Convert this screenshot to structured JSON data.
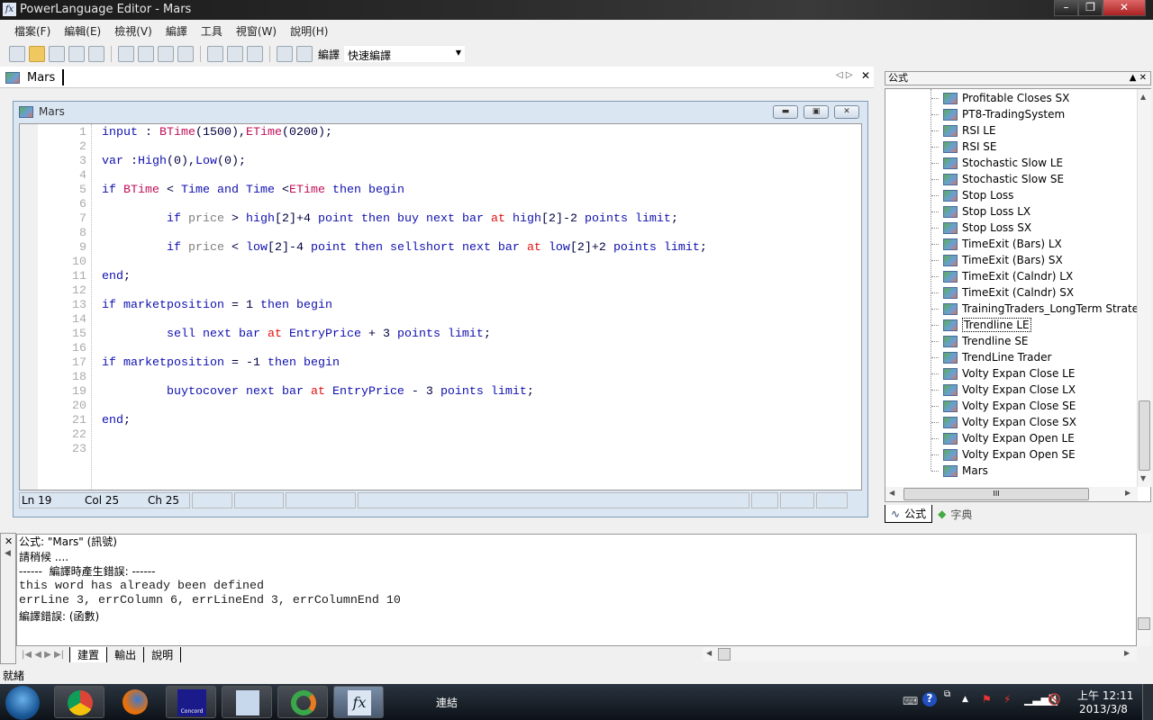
{
  "window": {
    "title": "PowerLanguage Editor - Mars"
  },
  "menu": [
    "檔案(F)",
    "編輯(E)",
    "檢視(V)",
    "編譯",
    "工具",
    "視窗(W)",
    "說明(H)"
  ],
  "toolbar": {
    "compile_label": "編譯",
    "mode_value": "快速編譯"
  },
  "doc_tab": {
    "label": "Mars"
  },
  "editor": {
    "title": "Mars",
    "lines": [
      [
        [
          "input",
          "k"
        ],
        [
          " : ",
          "o"
        ],
        [
          "BTime",
          "v"
        ],
        [
          "(1500),",
          "o"
        ],
        [
          "ETime",
          "v"
        ],
        [
          "(0200);",
          "o"
        ]
      ],
      [],
      [
        [
          "var",
          "k"
        ],
        [
          " :",
          "o"
        ],
        [
          "High",
          "k"
        ],
        [
          "(0),",
          "o"
        ],
        [
          "Low",
          "k"
        ],
        [
          "(0);",
          "o"
        ]
      ],
      [],
      [
        [
          "if",
          "k"
        ],
        [
          " ",
          "o"
        ],
        [
          "BTime",
          "v"
        ],
        [
          " < ",
          "o"
        ],
        [
          "Time",
          "k"
        ],
        [
          " ",
          "o"
        ],
        [
          "and",
          "k"
        ],
        [
          " ",
          "o"
        ],
        [
          "Time",
          "k"
        ],
        [
          " <",
          "o"
        ],
        [
          "ETime",
          "v"
        ],
        [
          " ",
          "o"
        ],
        [
          "then begin",
          "k"
        ]
      ],
      [],
      [
        [
          "         if",
          "k"
        ],
        [
          " ",
          "o"
        ],
        [
          "price",
          "g"
        ],
        [
          " > ",
          "o"
        ],
        [
          "high",
          "k"
        ],
        [
          "[2]+4 ",
          "o"
        ],
        [
          "point then buy next bar",
          "k"
        ],
        [
          " ",
          "o"
        ],
        [
          "at",
          "r"
        ],
        [
          " ",
          "o"
        ],
        [
          "high",
          "k"
        ],
        [
          "[2]-2 ",
          "o"
        ],
        [
          "points limit",
          "k"
        ],
        [
          ";",
          "o"
        ]
      ],
      [],
      [
        [
          "         if",
          "k"
        ],
        [
          " ",
          "o"
        ],
        [
          "price",
          "g"
        ],
        [
          " < ",
          "o"
        ],
        [
          "low",
          "k"
        ],
        [
          "[2]-4 ",
          "o"
        ],
        [
          "point then sellshort next bar",
          "k"
        ],
        [
          " ",
          "o"
        ],
        [
          "at",
          "r"
        ],
        [
          " ",
          "o"
        ],
        [
          "low",
          "k"
        ],
        [
          "[2]+2 ",
          "o"
        ],
        [
          "points limit",
          "k"
        ],
        [
          ";",
          "o"
        ]
      ],
      [],
      [
        [
          "end",
          "k"
        ],
        [
          ";",
          "o"
        ]
      ],
      [],
      [
        [
          "if marketposition",
          "k"
        ],
        [
          " = 1 ",
          "o"
        ],
        [
          "then begin",
          "k"
        ]
      ],
      [],
      [
        [
          "         sell next bar",
          "k"
        ],
        [
          " ",
          "o"
        ],
        [
          "at",
          "r"
        ],
        [
          " ",
          "o"
        ],
        [
          "EntryPrice",
          "k"
        ],
        [
          " + 3 ",
          "o"
        ],
        [
          "points limit",
          "k"
        ],
        [
          ";",
          "o"
        ]
      ],
      [],
      [
        [
          "if marketposition",
          "k"
        ],
        [
          " = -1 ",
          "o"
        ],
        [
          "then begin",
          "k"
        ]
      ],
      [],
      [
        [
          "         buytocover next bar",
          "k"
        ],
        [
          " ",
          "o"
        ],
        [
          "at",
          "r"
        ],
        [
          " ",
          "o"
        ],
        [
          "EntryPrice",
          "k"
        ],
        [
          " - 3 ",
          "o"
        ],
        [
          "points limit",
          "k"
        ],
        [
          ";",
          "o"
        ]
      ],
      [],
      [
        [
          "end",
          "k"
        ],
        [
          ";",
          "o"
        ]
      ],
      [],
      []
    ],
    "status": {
      "ln": "Ln 19",
      "col": "Col 25",
      "ch": "Ch 25"
    }
  },
  "right_panel": {
    "title": "公式",
    "items": [
      "Profitable Closes SX",
      "PT8-TradingSystem",
      "RSI LE",
      "RSI SE",
      "Stochastic Slow LE",
      "Stochastic Slow SE",
      "Stop Loss",
      "Stop Loss LX",
      "Stop Loss SX",
      "TimeExit (Bars) LX",
      "TimeExit (Bars) SX",
      "TimeExit (Calndr) LX",
      "TimeExit (Calndr) SX",
      "TrainingTraders_LongTerm Strategy",
      "Trendline LE",
      "Trendline SE",
      "TrendLine Trader",
      "Volty Expan Close LE",
      "Volty Expan Close LX",
      "Volty Expan Close SE",
      "Volty Expan Close SX",
      "Volty Expan Open LE",
      "Volty Expan Open SE",
      "Mars"
    ],
    "selected": "Trendline LE",
    "tabs": [
      "公式",
      "字典"
    ]
  },
  "output": {
    "lines": [
      "公式: \"Mars\" (訊號)",
      "請稍候 ....",
      "------  編譯時產生錯誤: ------",
      "this word has already been defined",
      "errLine 3, errColumn 6, errLineEnd 3, errColumnEnd 10",
      "編譯錯誤: (函數)"
    ],
    "tabs": [
      "建置",
      "輸出",
      "說明"
    ]
  },
  "statusbar": {
    "text": "就緒"
  },
  "taskbar": {
    "toolbar_label": "連結",
    "time": "上午 12:11",
    "date": "2013/3/8"
  }
}
